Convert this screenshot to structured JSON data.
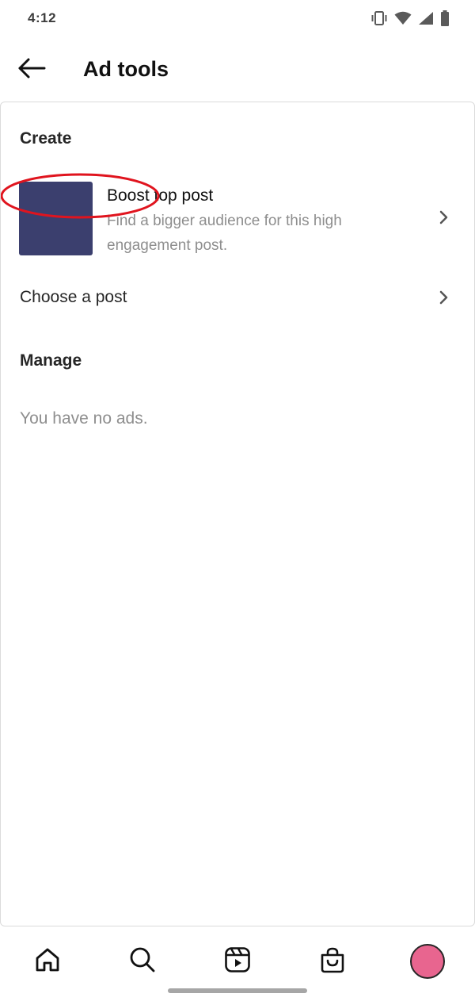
{
  "status_bar": {
    "time": "4:12",
    "icons": [
      "vibrate-icon",
      "wifi-icon",
      "cellular-signal-icon",
      "battery-icon"
    ]
  },
  "header": {
    "title": "Ad tools",
    "back_icon": "arrow-left-icon"
  },
  "create_section": {
    "heading": "Create",
    "boost_item": {
      "title": "Boost top post",
      "description": "Find a bigger audience for this high engagement post.",
      "thumbnail_color": "#3b3f6e"
    },
    "choose_item": {
      "label": "Choose a post"
    }
  },
  "manage_section": {
    "heading": "Manage",
    "empty_message": "You have no ads."
  },
  "bottom_nav": {
    "items": [
      "home-icon",
      "search-icon",
      "reels-icon",
      "shop-icon",
      "profile-avatar"
    ],
    "avatar_color": "#e8658f"
  },
  "annotation": {
    "color": "#e0141e"
  }
}
